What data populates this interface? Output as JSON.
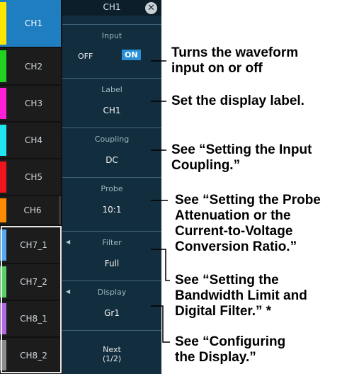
{
  "channels": [
    {
      "label": "CH1",
      "color": "#ffe600"
    },
    {
      "label": "CH2",
      "color": "#1fd31f"
    },
    {
      "label": "CH3",
      "color": "#ff1fd6"
    },
    {
      "label": "CH4",
      "color": "#1fe6f0"
    },
    {
      "label": "CH5",
      "color": "#f0141e"
    },
    {
      "label": "CH6",
      "color": "#ff8c00"
    },
    {
      "label": "CH7_1",
      "color": "#5aa8f0"
    },
    {
      "label": "CH7_2",
      "color": "#5dcf6a"
    },
    {
      "label": "CH8_1",
      "color": "#b06be0"
    },
    {
      "label": "CH8_2",
      "color": "#8e8e8e"
    }
  ],
  "menu": {
    "title": "CH1",
    "input": {
      "caption": "Input",
      "off": "OFF",
      "on": "ON"
    },
    "label": {
      "caption": "Label",
      "value": "CH1"
    },
    "coupling": {
      "caption": "Coupling",
      "value": "DC"
    },
    "probe": {
      "caption": "Probe",
      "value": "10:1"
    },
    "filter": {
      "caption": "Filter",
      "value": "Full"
    },
    "display": {
      "caption": "Display",
      "value": "Gr1"
    },
    "next": {
      "line1": "Next",
      "line2": "(1/2)"
    }
  },
  "annotations": {
    "input": [
      "Turns the waveform",
      "input on or off"
    ],
    "label": [
      "Set the display label."
    ],
    "coupling": [
      "See “Setting the Input",
      "Coupling.”"
    ],
    "probe": [
      "See “Setting the Probe",
      "Attenuation or the",
      "Current-to-Voltage",
      "Conversion Ratio.”"
    ],
    "filter": [
      "See “Setting the",
      "Bandwidth Limit and",
      "Digital Filter.”  *"
    ],
    "display": [
      "See “Configuring",
      "the Display.”"
    ]
  }
}
